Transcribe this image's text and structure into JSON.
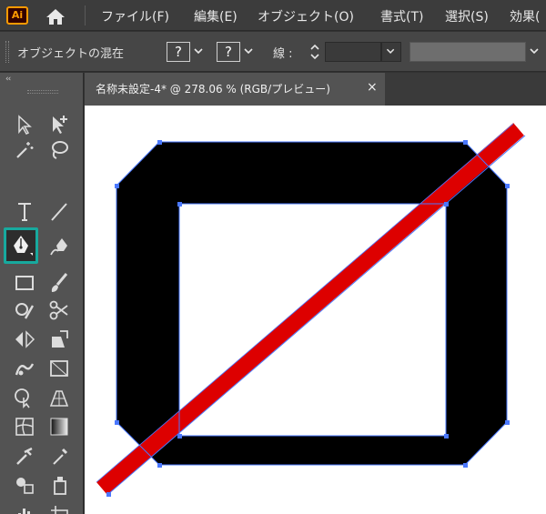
{
  "app": {
    "logo_text": "Ai",
    "brand_color": "#ff9a00"
  },
  "menu": {
    "items": [
      {
        "label": "ファイル(F)"
      },
      {
        "label": "編集(E)"
      },
      {
        "label": "オブジェクト(O)"
      },
      {
        "label": "書式(T)"
      },
      {
        "label": "選択(S)"
      },
      {
        "label": "効果("
      }
    ]
  },
  "control_bar": {
    "blend_label": "オブジェクトの混在",
    "fill_value": "?",
    "stroke_value": "?",
    "stroke_label": "線 :",
    "stroke_weight": ""
  },
  "tools_panel": {
    "collapse_label": "‹‹",
    "selected_tool": "pen-tool",
    "highlight_color": "#17a99e"
  },
  "document": {
    "tab_title": "名称未設定-4* @ 278.06 % (RGB/プレビュー)",
    "close_label": "×",
    "selection_color": "#4a78ff",
    "red_stroke_color": "#dd0000",
    "shape_fill": "#000000"
  }
}
